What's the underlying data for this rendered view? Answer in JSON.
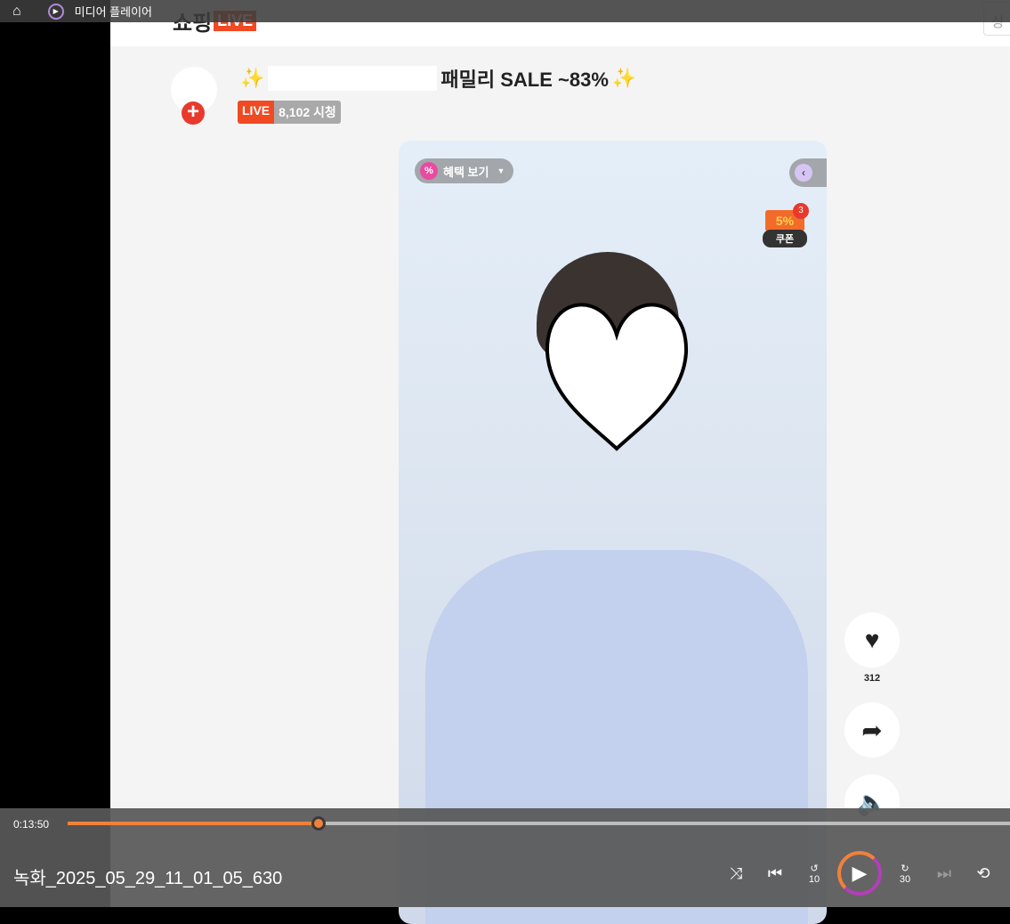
{
  "app": {
    "title": "미디어 플레이어"
  },
  "web": {
    "logo_text": "쇼핑",
    "logo_live": "LIVE",
    "search_hint": "상",
    "stream_title": "패밀리 SALE ~83%",
    "sparkle": "✨",
    "live_badge": "LIVE",
    "viewers": "8,102 시청",
    "benefit_label": "혜택 보기",
    "benefit_icon": "%",
    "coupon_pct": "5%",
    "coupon_count": "3",
    "coupon_label": "쿠폰",
    "likes": "312"
  },
  "player": {
    "current_time": "0:13:50",
    "progress_fraction": 0.266,
    "file_name": "녹화_2025_05_29_11_01_05_630",
    "rewind": "10",
    "forward": "30"
  }
}
